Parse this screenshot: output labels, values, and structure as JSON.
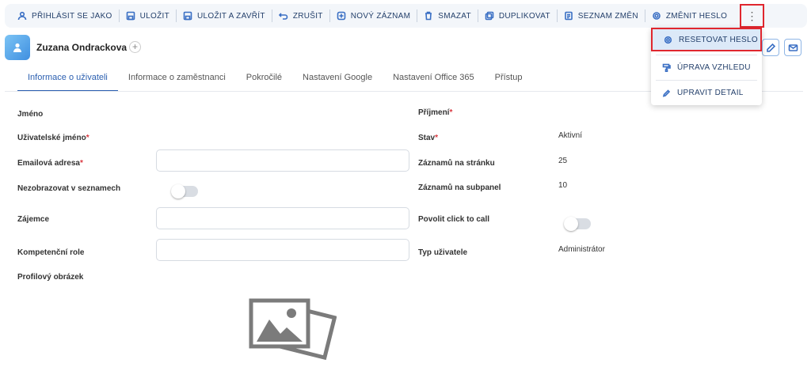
{
  "toolbar": {
    "buttons": [
      {
        "label": "PŘIHLÁSIT SE JAKO",
        "icon": "user-icon"
      },
      {
        "label": "ULOŽIT",
        "icon": "save-icon"
      },
      {
        "label": "ULOŽIT A ZAVŘÍT",
        "icon": "save-close-icon"
      },
      {
        "label": "ZRUŠIT",
        "icon": "undo-icon"
      },
      {
        "label": "NOVÝ ZÁZNAM",
        "icon": "plus-circle-icon"
      },
      {
        "label": "SMAZAT",
        "icon": "trash-icon"
      },
      {
        "label": "DUPLIKOVAT",
        "icon": "duplicate-icon"
      },
      {
        "label": "SEZNAM ZMĚN",
        "icon": "changelog-icon"
      },
      {
        "label": "ZMĚNIT HESLO",
        "icon": "gear-icon"
      }
    ],
    "more": "⋮"
  },
  "header": {
    "record_name": "Zuzana Ondrackova",
    "add_symbol": "+"
  },
  "tabs": [
    {
      "label": "Informace o uživateli",
      "active": true
    },
    {
      "label": "Informace o zaměstnanci"
    },
    {
      "label": "Pokročilé"
    },
    {
      "label": "Nastavení Google"
    },
    {
      "label": "Nastavení Office 365"
    },
    {
      "label": "Přístup"
    }
  ],
  "left_fields": {
    "first_name": {
      "label": "Jméno"
    },
    "username": {
      "label": "Uživatelské jméno",
      "required": "*"
    },
    "email": {
      "label": "Emailová adresa",
      "required": "*",
      "value": ""
    },
    "hide_in_lists": {
      "label": "Nezobrazovat v seznamech",
      "checked": false
    },
    "lead": {
      "label": "Zájemce",
      "value": ""
    },
    "competence_role": {
      "label": "Kompetenční role",
      "value": ""
    },
    "profile_picture": {
      "label": "Profilový obrázek"
    }
  },
  "right_fields": {
    "last_name": {
      "label": "Příjmení",
      "required": "*"
    },
    "status": {
      "label": "Stav",
      "required": "*",
      "value": "Aktivní"
    },
    "records_per_page": {
      "label": "Záznamů na stránku",
      "value": "25"
    },
    "records_per_subpanel": {
      "label": "Záznamů na subpanel",
      "value": "10"
    },
    "click_to_call": {
      "label": "Povolit click to call",
      "checked": false
    },
    "user_type": {
      "label": "Typ uživatele",
      "value": "Administrátor"
    }
  },
  "dropdown": {
    "items": [
      {
        "label": "RESETOVAT HESLO",
        "icon": "gear-icon",
        "highlighted": true
      },
      {
        "label": "ÚPRAVA VZHLEDU",
        "icon": "paint-roller-icon"
      },
      {
        "label": "UPRAVIT DETAIL",
        "icon": "pencil-icon"
      }
    ]
  },
  "colors": {
    "accent": "#2b5fb0",
    "highlight_border": "#e0262e",
    "required": "#d9363e"
  }
}
